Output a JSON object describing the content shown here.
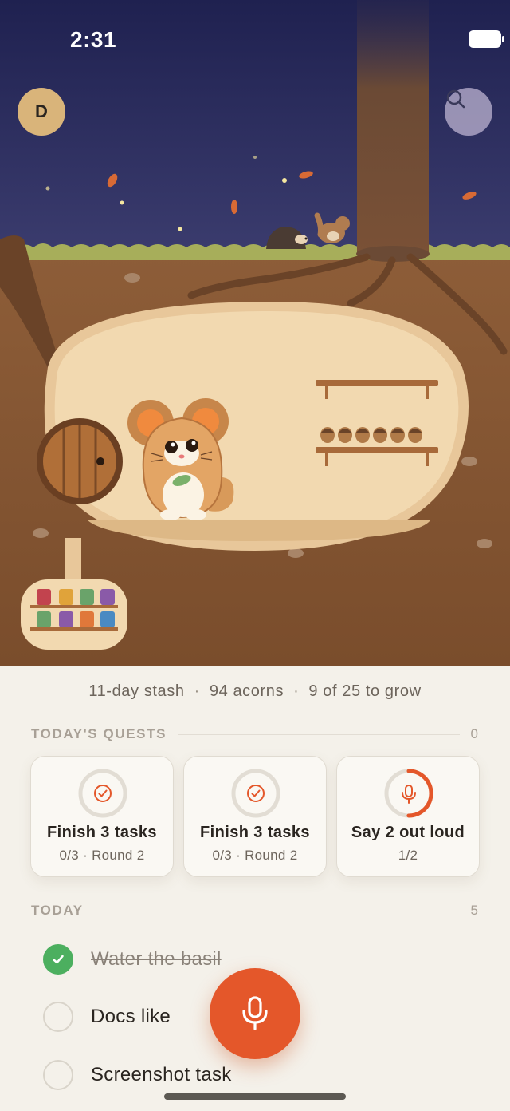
{
  "status_bar": {
    "time": "2:31"
  },
  "header": {
    "avatar_initial": "D"
  },
  "stats": {
    "streak": "11-day stash",
    "acorns": "94 acorns",
    "progress": "9 of 25 to grow",
    "separator": "·"
  },
  "quests_section": {
    "title": "TODAY'S QUESTS",
    "count": "0",
    "cards": [
      {
        "title": "Finish 3 tasks",
        "subtitle": "0/3 · Round 2",
        "icon": "check-circle-icon",
        "progress": 0
      },
      {
        "title": "Finish 3 tasks",
        "subtitle": "0/3 · Round 2",
        "icon": "check-circle-icon",
        "progress": 0
      },
      {
        "title": "Say 2 out loud",
        "subtitle": "1/2",
        "icon": "mic-icon",
        "progress": 0.5
      }
    ]
  },
  "today_section": {
    "title": "TODAY",
    "count": "5",
    "tasks": [
      {
        "label": "Water the basil",
        "done": true
      },
      {
        "label": "Docs like",
        "done": false
      },
      {
        "label": "Screenshot task",
        "done": false
      }
    ]
  },
  "colors": {
    "accent": "#e4572a",
    "done_green": "#4caf5f",
    "sky": "#2d2f5e",
    "soil": "#8b5a35"
  }
}
